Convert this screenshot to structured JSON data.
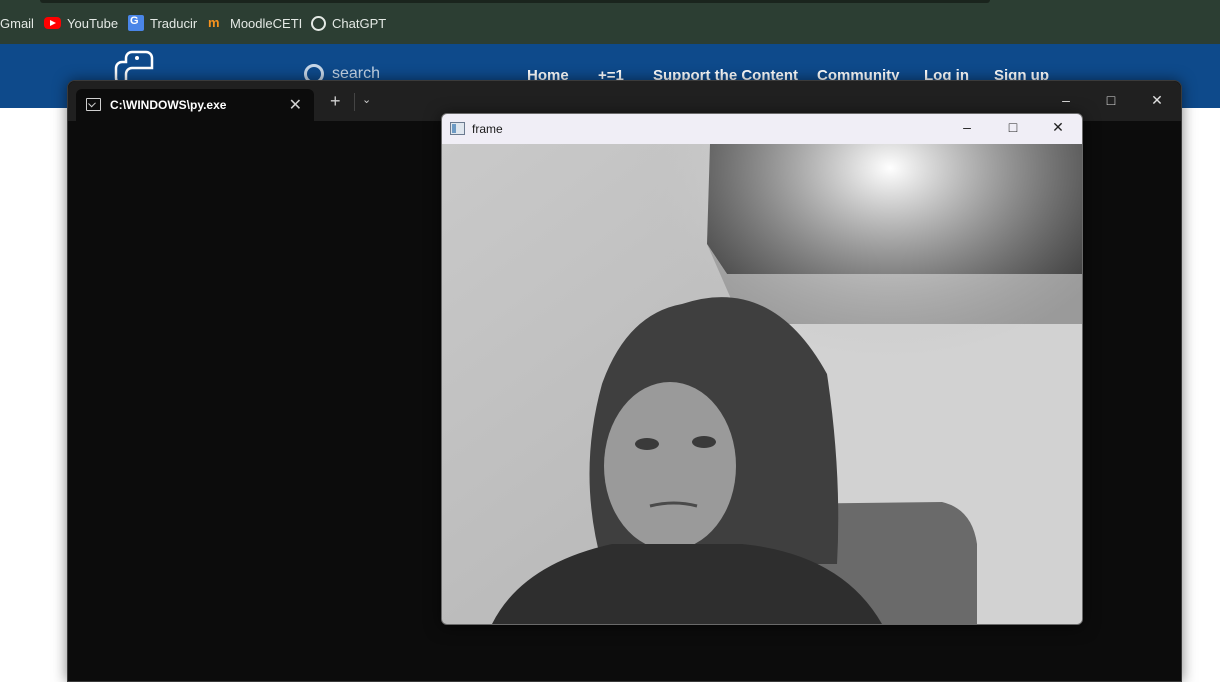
{
  "bookmarks": {
    "items": [
      {
        "label": "Gmail",
        "icon": "gmail-icon"
      },
      {
        "label": "YouTube",
        "icon": "youtube-icon"
      },
      {
        "label": "Traducir",
        "icon": "google-translate-icon"
      },
      {
        "label": "MoodleCETI",
        "icon": "moodle-icon"
      },
      {
        "label": "ChatGPT",
        "icon": "chatgpt-icon"
      }
    ]
  },
  "site": {
    "search_label": "search",
    "nav": [
      "Home",
      "+=1",
      "Support the Content",
      "Community",
      "Log in",
      "Sign up"
    ],
    "header_color": "#0e4a8b"
  },
  "terminal": {
    "tab_title": "C:\\WINDOWS\\py.exe",
    "new_tab": "+",
    "close_glyph": "✕"
  },
  "frame_window": {
    "title": "frame",
    "content": "grayscale webcam image"
  }
}
